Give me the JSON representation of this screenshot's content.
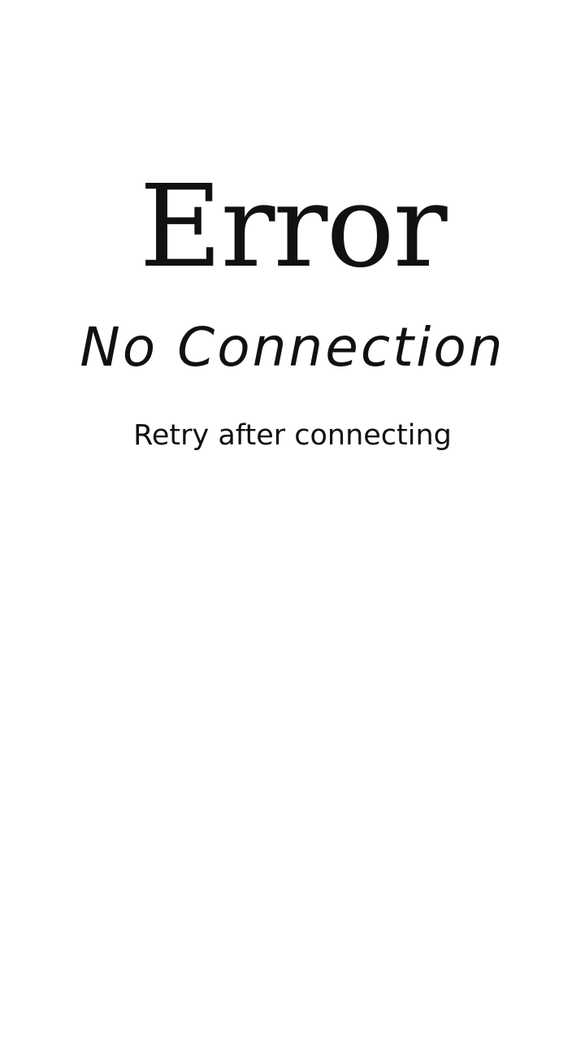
{
  "error": {
    "title": "Error",
    "status": "No Connection",
    "hint": "Retry after connecting"
  },
  "colors": {
    "background": "#ffffff",
    "text": "#111111"
  }
}
